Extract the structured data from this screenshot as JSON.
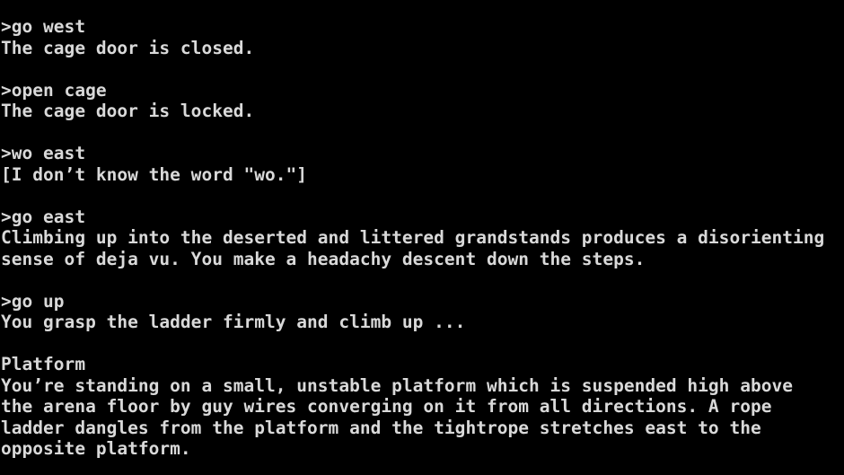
{
  "colors": {
    "background": "#000000",
    "text": "#d9d9d9"
  },
  "transcript": {
    "lines": [
      ">go west",
      "The cage door is closed.",
      ">open cage",
      "The cage door is locked.",
      ">wo east",
      "[I don’t know the word \"wo.\"]",
      ">go east",
      "Climbing up into the deserted and littered grandstands produces a disorienting",
      "sense of deja vu. You make a headachy descent down the steps.",
      ">go up",
      "You grasp the ladder firmly and climb up ...",
      "Platform",
      "You’re standing on a small, unstable platform which is suspended high above",
      "the arena floor by guy wires converging on it from all directions. A rope",
      "ladder dangles from the platform and the tightrope stretches east to the",
      "opposite platform."
    ]
  }
}
